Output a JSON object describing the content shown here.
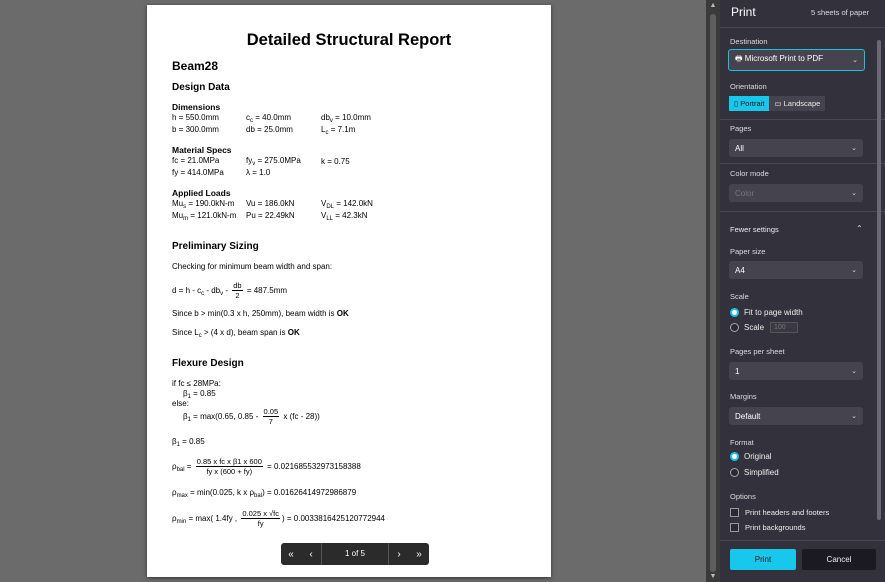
{
  "report": {
    "title": "Detailed Structural Report",
    "beam": "Beam28",
    "design_data": "Design Data",
    "dimensions": {
      "heading": "Dimensions",
      "h": "h = 550.0mm",
      "b": "b = 300.0mm",
      "cc_pre": "c",
      "cc_sub": "c",
      "cc_post": " = 40.0mm",
      "db": "db = 25.0mm",
      "dbv_pre": "db",
      "dbv_sub": "v",
      "dbv_post": " = 10.0mm",
      "lc_pre": "L",
      "lc_sub": "c",
      "lc_post": " = 7.1m"
    },
    "material": {
      "heading": "Material Specs",
      "fc": "fc = 21.0MPa",
      "fy": "fy = 414.0MPa",
      "fyv_pre": "fy",
      "fyv_sub": "v",
      "fyv_post": " = 275.0MPa",
      "lambda": "λ = 1.0",
      "k": "k = 0.75"
    },
    "loads": {
      "heading": "Applied Loads",
      "mus_pre": "Mu",
      "mus_sub": "s",
      "mus_post": " = 190.0kN-m",
      "mum_pre": "Mu",
      "mum_sub": "m",
      "mum_post": " = 121.0kN-m",
      "vu": "Vu = 186.0kN",
      "pu": "Pu = 22.49kN",
      "vdl_pre": "V",
      "vdl_sub": "DL",
      "vdl_post": " = 142.0kN",
      "vll_pre": "V",
      "vll_sub": "LL",
      "vll_post": " = 42.3kN"
    },
    "sizing": {
      "heading": "Preliminary Sizing",
      "check": "Checking for minimum beam width and span:",
      "d_pre": "d = h - c",
      "d_sub1": "c",
      "d_mid": " - db",
      "d_sub2": "v",
      "d_minus": " - ",
      "d_num": "db",
      "d_den": "2",
      "d_post": " = 487.5mm",
      "since1_pre": "Since b > min(0.3 x h, 250mm), beam width is ",
      "since1_ok": "OK",
      "since2_pre": "Since L",
      "since2_sub": "c",
      "since2_mid": " > (4 x d), beam span is ",
      "since2_ok": "OK"
    },
    "flexure": {
      "heading": "Flexure Design",
      "if": "if fc ≤ 28MPa:",
      "b1a_pre": "β",
      "b1a_sub": "1",
      "b1a_post": " = 0.85",
      "else": "else:",
      "b1b_pre": "β",
      "b1b_sub": "1",
      "b1b_mid": " = max(0.65, 0.85 - ",
      "b1b_num": "0.05",
      "b1b_den": "7",
      "b1b_post": " x (fc - 28))",
      "b1c_pre": "β",
      "b1c_sub": "1",
      "b1c_post": " = 0.85",
      "pbal_pre": "ρ",
      "pbal_sub": "bal",
      "pbal_eq": " = ",
      "pbal_num": "0.85 x fc x β1 x 600",
      "pbal_den": "fy x (600 + fy)",
      "pbal_post": " = 0.021685532973158388",
      "pmax_pre": "ρ",
      "pmax_sub": "max",
      "pmax_mid": " = min(0.025, k x ρ",
      "pmax_sub2": "bal",
      "pmax_post": ") = 0.01626414972986879",
      "pmin_pre": "ρ",
      "pmin_sub": "min",
      "pmin_mid": " = max( 1.4fy , ",
      "pmin_num": "0.025 x √fc",
      "pmin_den": "fy",
      "pmin_post": ") = 0.0033816425120772944"
    }
  },
  "pager": {
    "first": "«",
    "prev": "‹",
    "info": "1 of 5",
    "next": "›",
    "last": "»"
  },
  "panel": {
    "title": "Print",
    "sheets": "5 sheets of paper",
    "destination_label": "Destination",
    "destination_value": "Microsoft Print to PDF",
    "orientation_label": "Orientation",
    "portrait": "Portrait",
    "landscape": "Landscape",
    "pages_label": "Pages",
    "pages_value": "All",
    "color_label": "Color mode",
    "color_value": "Color",
    "fewer": "Fewer settings",
    "paper_label": "Paper size",
    "paper_value": "A4",
    "scale_label": "Scale",
    "fit": "Fit to page width",
    "scale_opt": "Scale",
    "scale_value": "100",
    "pps_label": "Pages per sheet",
    "pps_value": "1",
    "margins_label": "Margins",
    "margins_value": "Default",
    "format_label": "Format",
    "original": "Original",
    "simplified": "Simplified",
    "options_label": "Options",
    "headers": "Print headers and footers",
    "backgrounds": "Print backgrounds",
    "print": "Print",
    "cancel": "Cancel"
  },
  "colors": {
    "accent": "#18c8ec",
    "panel_bg": "#33313b",
    "preview_bg": "#6b6b6b"
  }
}
